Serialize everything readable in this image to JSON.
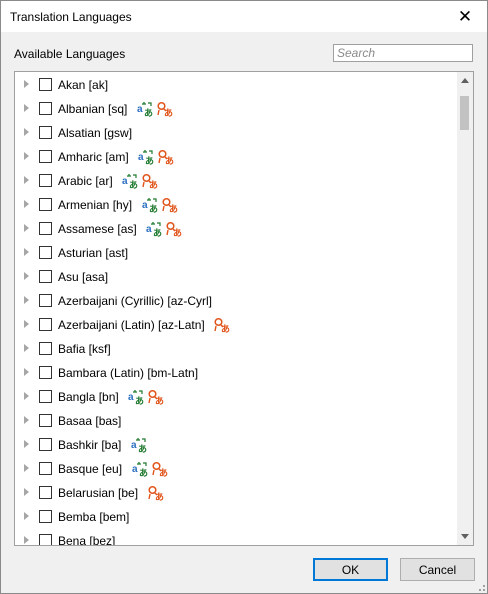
{
  "window": {
    "title": "Translation Languages",
    "close_glyph": "✕"
  },
  "available": {
    "label": "Available Languages"
  },
  "search": {
    "placeholder": "Search",
    "value": ""
  },
  "languages": [
    {
      "label": "Akan [ak]",
      "icons": []
    },
    {
      "label": "Albanian [sq]",
      "icons": [
        "translate-icon",
        "speech-icon"
      ]
    },
    {
      "label": "Alsatian [gsw]",
      "icons": []
    },
    {
      "label": "Amharic [am]",
      "icons": [
        "translate-icon",
        "speech-icon"
      ]
    },
    {
      "label": "Arabic [ar]",
      "icons": [
        "translate-icon",
        "speech-icon"
      ]
    },
    {
      "label": "Armenian [hy]",
      "icons": [
        "translate-icon",
        "speech-icon"
      ]
    },
    {
      "label": "Assamese [as]",
      "icons": [
        "translate-icon",
        "speech-icon"
      ]
    },
    {
      "label": "Asturian [ast]",
      "icons": []
    },
    {
      "label": "Asu [asa]",
      "icons": []
    },
    {
      "label": "Azerbaijani (Cyrillic) [az-Cyrl]",
      "icons": []
    },
    {
      "label": "Azerbaijani (Latin) [az-Latn]",
      "icons": [
        "speech-icon"
      ]
    },
    {
      "label": "Bafia [ksf]",
      "icons": []
    },
    {
      "label": "Bambara (Latin) [bm-Latn]",
      "icons": []
    },
    {
      "label": "Bangla [bn]",
      "icons": [
        "translate-icon",
        "speech-icon"
      ]
    },
    {
      "label": "Basaa [bas]",
      "icons": []
    },
    {
      "label": "Bashkir [ba]",
      "icons": [
        "translate-icon"
      ]
    },
    {
      "label": "Basque [eu]",
      "icons": [
        "translate-icon",
        "speech-icon"
      ]
    },
    {
      "label": "Belarusian [be]",
      "icons": [
        "speech-icon"
      ]
    },
    {
      "label": "Bemba [bem]",
      "icons": []
    },
    {
      "label": "Bena [bez]",
      "icons": []
    }
  ],
  "colors": {
    "translate": "#1f7a2e",
    "translate_blue": "#2a6fbf",
    "speech": "#e0541a",
    "accent": "#0078d7"
  },
  "buttons": {
    "ok": "OK",
    "cancel": "Cancel"
  }
}
